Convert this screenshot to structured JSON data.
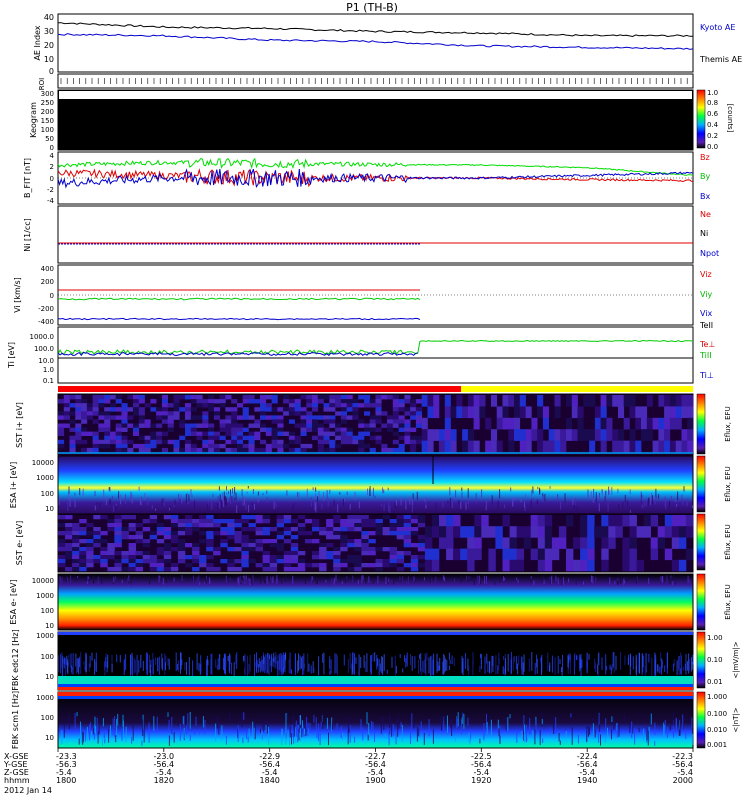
{
  "title": "P1 (TH-B)",
  "footer": {
    "rows": [
      "X-GSE",
      "Y-GSE",
      "Z-GSE",
      "hhmm",
      "2012 Jan 14"
    ],
    "x_values": [
      "-23.3",
      "-23.0",
      "-22.9",
      "-22.7",
      "-22.5",
      "-22.4",
      "-22.3"
    ],
    "y_values": [
      "-56.3",
      "-56.4",
      "-56.4",
      "-56.4",
      "-56.4",
      "-56.4",
      "-56.4"
    ],
    "z_values": [
      "-5.4",
      "-5.4",
      "-5.4",
      "-5.4",
      "-5.4",
      "-5.4",
      "-5.4"
    ],
    "time_ticks": [
      "1800",
      "1820",
      "1840",
      "1900",
      "1920",
      "1940",
      "2000"
    ]
  },
  "panels": {
    "ae": {
      "ylabel": "AE Index",
      "yticks": [
        "40",
        "30",
        "20",
        "10",
        "0"
      ],
      "legend": [
        "Kyoto AE",
        "Themis AE"
      ]
    },
    "roi": {
      "ylabel": "ROI"
    },
    "keogram": {
      "ylabel": "Keogram",
      "yticks": [
        "300",
        "250",
        "200",
        "150",
        "100",
        "50",
        "0"
      ],
      "colorbar_ticks": [
        "1.0",
        "0.8",
        "0.6",
        "0.4",
        "0.2",
        "0.0"
      ],
      "colorbar_label": "[counts]"
    },
    "bfield": {
      "ylabel": "B_FIT [nT]",
      "yticks": [
        "4",
        "2",
        "0",
        "-2",
        "-4"
      ],
      "legend": [
        "Bz",
        "By",
        "Bx"
      ]
    },
    "density": {
      "ylabel": "Ni [1/cc]",
      "legend": [
        "Ne",
        "Ni",
        "Npot"
      ]
    },
    "velocity": {
      "ylabel": "Vi [km/s]",
      "yticks": [
        "400",
        "200",
        "0",
        "-200",
        "-400"
      ],
      "legend": [
        "Viz",
        "Viy",
        "Vix"
      ]
    },
    "temperature": {
      "ylabel": "Ti [eV]",
      "yticks": [
        "1000.0",
        "100.0",
        "10.0",
        "1.0",
        "0.1"
      ],
      "legend": [
        "TeII",
        "Te⊥",
        "TiII",
        "Ti⊥"
      ]
    },
    "sst1": {
      "ylabel": "SST i+ [eV]",
      "colorbar_label": "Eflux, EFU"
    },
    "esa1": {
      "ylabel": "ESA i+ [eV]",
      "yticks": [
        "10000",
        "1000",
        "100",
        "10"
      ],
      "colorbar_label": "Eflux, EFU"
    },
    "sst2": {
      "ylabel": "SST e- [eV]",
      "colorbar_label": "Eflux, EFU"
    },
    "esa2": {
      "ylabel": "ESA e- [eV]",
      "yticks": [
        "10000",
        "1000",
        "100",
        "10"
      ],
      "colorbar_label": "Eflux, EFU"
    },
    "fbk1": {
      "ylabel": "FBK edc12 [Hz]",
      "yticks": [
        "1000",
        "100",
        "10"
      ],
      "colorbar_ticks": [
        "1.00",
        "0.10",
        "0.01"
      ],
      "colorbar_label": "<|mV/m|>"
    },
    "fbk2": {
      "ylabel": "FBK scm1 [Hz]",
      "yticks": [
        "1000",
        "100",
        "10"
      ],
      "colorbar_ticks": [
        "1.000",
        "0.100",
        "0.010",
        "0.001"
      ],
      "colorbar_label": "<|nT|>"
    }
  },
  "chart_data": {
    "type": "line",
    "title": "P1 (TH-B)",
    "x": [
      "1800",
      "1820",
      "1840",
      "1900",
      "1920",
      "1940",
      "2000"
    ],
    "xlabel": "hhmm",
    "series": [
      {
        "name": "Kyoto AE",
        "values": [
          34,
          31,
          30,
          28,
          27,
          25,
          25
        ]
      },
      {
        "name": "Themis AE",
        "values": [
          26,
          25,
          22,
          21,
          18,
          17,
          16
        ]
      },
      {
        "name": "Bz",
        "values": [
          1.0,
          0.5,
          0.0,
          0.0,
          0.0,
          -0.3,
          -0.5
        ]
      },
      {
        "name": "By",
        "values": [
          2.5,
          3.0,
          2.8,
          2.6,
          2.5,
          2.0,
          0.5
        ]
      },
      {
        "name": "Bx",
        "values": [
          -1.0,
          0.0,
          0.0,
          0.0,
          0.0,
          0.5,
          1.0
        ]
      }
    ],
    "ylim": [
      0,
      40
    ],
    "grid": false
  }
}
